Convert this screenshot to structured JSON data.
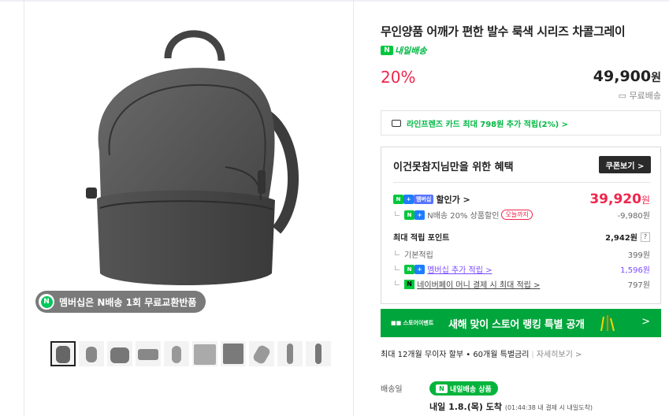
{
  "product": {
    "title": "무인양품 어깨가 편한 발수 룩색 시리즈 차콜그레이",
    "tomorrow_badge": "내일배송",
    "tomorrow_badge_icon": "N",
    "discount": "20%",
    "price": "49,900",
    "price_unit": "원",
    "shipping": "무료배송"
  },
  "member_badge": {
    "icon": "N",
    "text": "멤버십은 N배송 1회 무료교환반품"
  },
  "card_promo": "라인프렌즈 카드 최대 798원 추가 적립(2%) >",
  "benefit": {
    "title": "이건못참지님만을 위한 혜택",
    "coupon_button": "쿠폰보기 >",
    "sale_label": "할인가 >",
    "membership_tag": "멤버십",
    "sale_price": "39,920",
    "sale_unit": "원",
    "n_discount_label": "N배송 20% 상품할인",
    "n_discount_limit": "오늘까지",
    "n_discount_value": "-9,980원",
    "points_label": "최대 적립 포인트",
    "points_value": "2,942원",
    "points_help": "?",
    "base_label": "기본적립",
    "base_value": "399원",
    "membership_label": "멤버십 추가 적립 >",
    "membership_value": "1,596원",
    "naverpay_label": "네이버페이 머니 결제 시 최대 적립 >",
    "naverpay_value": "797원"
  },
  "tags": {
    "n": "N",
    "plus": "+",
    "np": "N"
  },
  "banner": {
    "logo": "■■ 스토어이벤트",
    "text": "새해 맞이 스토어 랭킹 특별 공개",
    "arrow": ">"
  },
  "installment": {
    "text": "최대 12개월 무이자 할부 • 60개월 특별금리",
    "link": "자세히보기 >"
  },
  "delivery": {
    "label": "배송일",
    "badge": "내일배송 상품",
    "badge_icon": "N",
    "date": "내일 1.8.(목) 도착",
    "detail": "(01:44:38 내 결제 시 내일도착)"
  },
  "colors": {
    "accent_red": "#f0254c",
    "naver_green": "#00c73c",
    "banner_green": "#00a63c"
  }
}
